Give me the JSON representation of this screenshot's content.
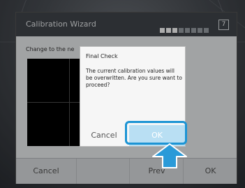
{
  "wizard": {
    "title": "Calibration Wizard",
    "step_number": "7",
    "instruction_prefix": "Change to the ne",
    "footer": {
      "cancel_label": "Cancel",
      "prev_label": "Prev",
      "ok_label": "OK"
    }
  },
  "dialog": {
    "title": "Final Check",
    "message": "The current calibration values will be overwritten. Are you sure want to proceed?",
    "cancel_label": "Cancel",
    "ok_label": "OK"
  },
  "colors": {
    "highlight": "#1c94d4",
    "ok_button": "#b9dff3",
    "titlebar": "#41464c"
  },
  "icons": {
    "pointer": "arrow-up-icon"
  }
}
